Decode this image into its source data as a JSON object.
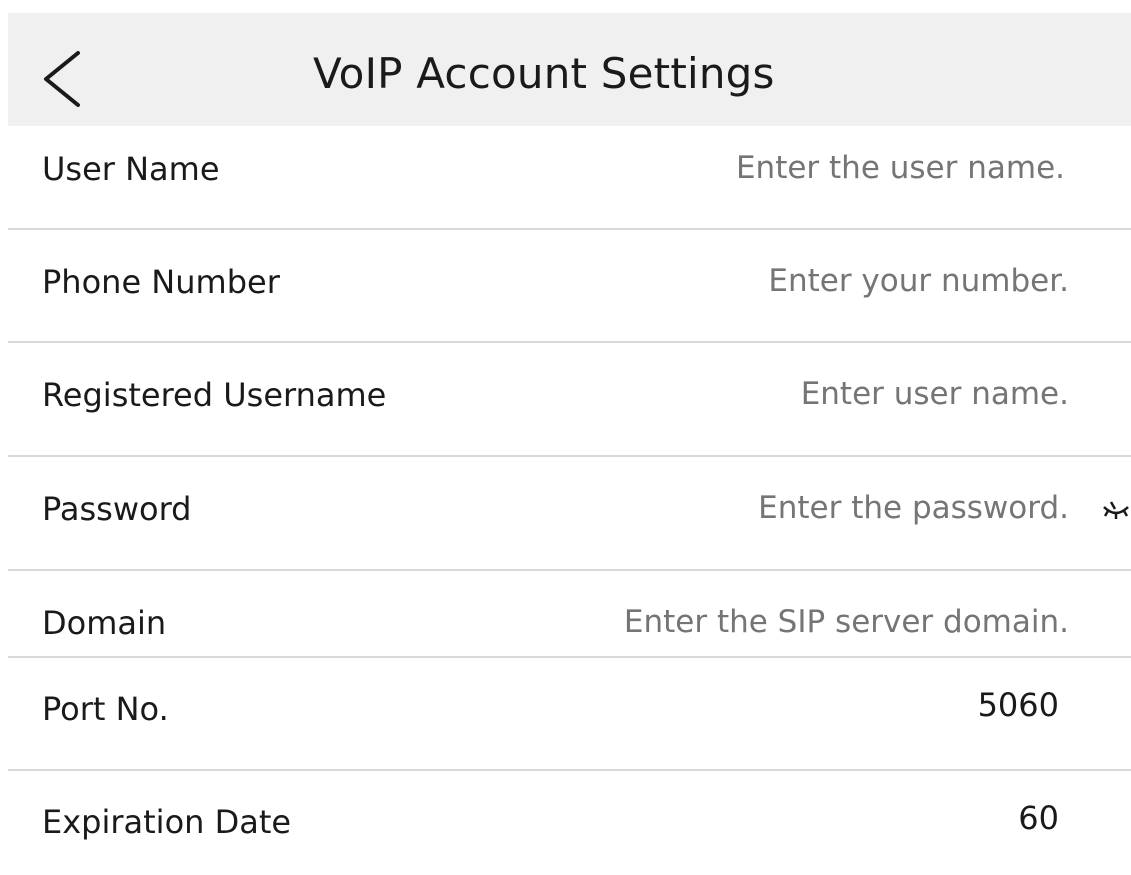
{
  "header": {
    "back_icon": "chevron-left-icon",
    "title": "VoIP Account Settings"
  },
  "fields": [
    {
      "label": "User Name",
      "placeholder": "Enter the user name."
    },
    {
      "label": "Phone Number",
      "placeholder": "Enter your number."
    },
    {
      "label": "Registered Username",
      "placeholder": "Enter user name."
    },
    {
      "label": "Password",
      "placeholder": "Enter the password.",
      "icon": "eye-closed-icon"
    },
    {
      "label": "Domain",
      "placeholder": "Enter the SIP server domain."
    },
    {
      "label": "Port No.",
      "value": "5060"
    },
    {
      "label": "Expiration Date",
      "value": "60"
    }
  ]
}
